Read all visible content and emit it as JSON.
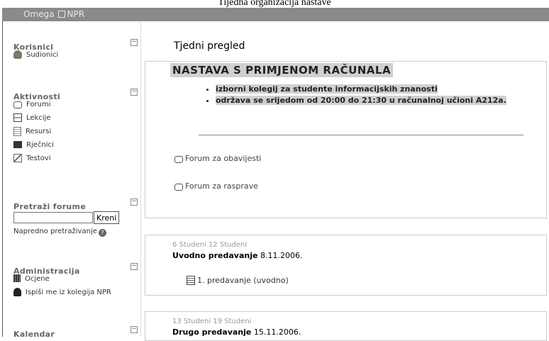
{
  "caption": "Tijedna organizacija nastave",
  "topbar": {
    "site": "Omega",
    "course": "NPR"
  },
  "sidebar": {
    "blocks": [
      {
        "title": "Korisnici",
        "toggle": "−",
        "items": [
          {
            "label": "Sudionici",
            "icon": "users-icon"
          }
        ]
      },
      {
        "title": "Aktivnosti",
        "toggle": "−",
        "items": [
          {
            "label": "Forumi",
            "icon": "forum-icon"
          },
          {
            "label": "Lekcije",
            "icon": "lesson-icon"
          },
          {
            "label": "Resursi",
            "icon": "resource-icon"
          },
          {
            "label": "Rječnici",
            "icon": "glossary-icon"
          },
          {
            "label": "Testovi",
            "icon": "quiz-icon"
          }
        ]
      },
      {
        "title": "Pretraži forume",
        "toggle": "−",
        "search_value": "",
        "button": "Kreni",
        "advanced": "Napredno pretraživanje"
      },
      {
        "title": "Administracija",
        "toggle": "−",
        "items": [
          {
            "label": "Ocjene",
            "icon": "grades-icon"
          },
          {
            "label": "Ispiši me iz kolegija NPR",
            "icon": "unenrol-icon"
          }
        ]
      },
      {
        "title": "Kalendar",
        "toggle": "−"
      }
    ]
  },
  "main": {
    "week_title": "Tjedni pregled",
    "course_heading": "NASTAVA S PRIMJENOM RAČUNALA",
    "bullets": [
      "izborni kolegij za studente informacijskih znanosti",
      "održava se srijedom od 20:00 do 21:30 u računalnoj učioni A212a."
    ],
    "forums": [
      "Forum za obavijesti",
      "Forum za rasprave"
    ],
    "weeks": [
      {
        "dates": "6 Studeni 12 Studeni",
        "title_bold": "Uvodno predavanje",
        "title_date": "8.11.2006.",
        "resource": "1. predavanje (uvodno)"
      },
      {
        "dates": "13 Studeni 19 Studeni",
        "title_bold": "Drugo predavanje",
        "title_date": "15.11.2006."
      }
    ]
  }
}
